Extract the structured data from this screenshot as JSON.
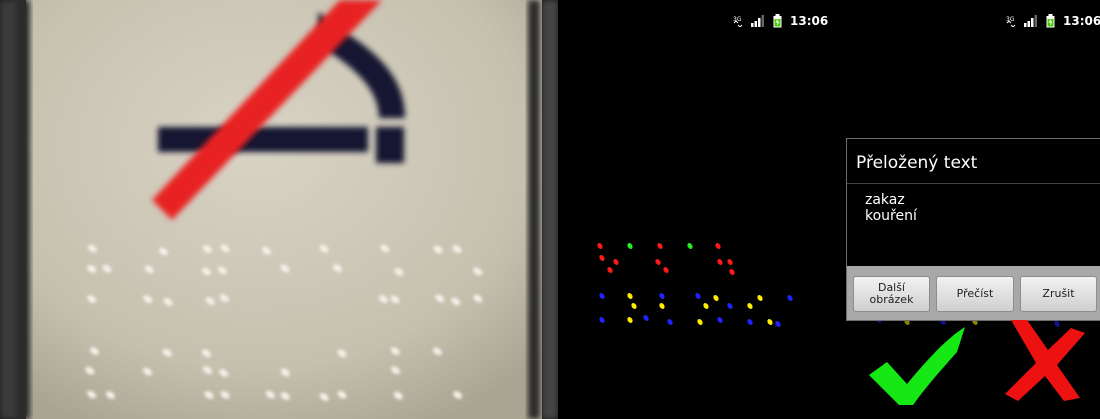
{
  "status_bar": {
    "time": "13:06",
    "network_label": "3G",
    "icons": [
      "network-type-icon",
      "signal-icon",
      "battery-icon"
    ]
  },
  "dialog": {
    "title": "Přeložený text",
    "body": "zakaz\nkouření",
    "buttons": {
      "next_image": "Další obrázek",
      "read": "Přečíst",
      "cancel": "Zrušit"
    }
  },
  "colors": {
    "dot_red": "#ff1a1a",
    "dot_green": "#22ee22",
    "dot_blue": "#2222ff",
    "dot_yellow": "#ffee00",
    "accept_green": "#16e816",
    "reject_red": "#ee1111",
    "battery_green": "#44c800",
    "sign_background": "#cfcabb",
    "sign_red_stroke": "#e82222"
  },
  "icons": {
    "accept": "checkmark-icon",
    "reject": "cross-icon"
  }
}
